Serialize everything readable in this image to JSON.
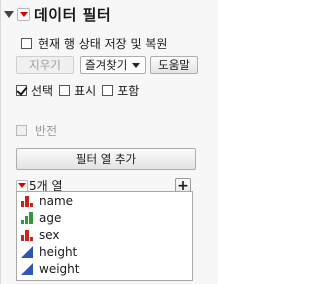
{
  "header": {
    "title": "데이터 필터"
  },
  "options": {
    "save_restore_label": "현재 행 상태 저장 및 복원",
    "save_restore_checked": false
  },
  "toolbar": {
    "clear_label": "지우기",
    "favorites_label": "즐겨찾기",
    "help_label": "도움말"
  },
  "modes": [
    {
      "label": "선택",
      "checked": true
    },
    {
      "label": "표시",
      "checked": false
    },
    {
      "label": "포함",
      "checked": false
    }
  ],
  "invert": {
    "label": "반전",
    "checked": false,
    "disabled": true
  },
  "add_filter": {
    "label": "필터 열 추가"
  },
  "columns": {
    "count_label": "5개 열",
    "items": [
      {
        "name": "name",
        "type": "nominal"
      },
      {
        "name": "age",
        "type": "ordinal"
      },
      {
        "name": "sex",
        "type": "nominal"
      },
      {
        "name": "height",
        "type": "continuous"
      },
      {
        "name": "weight",
        "type": "continuous"
      }
    ]
  },
  "colors": {
    "nominal": "#c8241c",
    "ordinal": "#2e9b3a",
    "continuous": "#2e56b8",
    "red_triangle": "#d40000"
  }
}
